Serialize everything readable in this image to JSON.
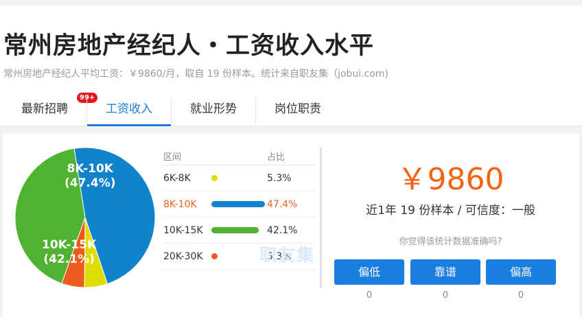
{
  "header": {
    "title": "常州房地产经纪人・工资收入水平",
    "subtitle": "常州房地产经纪人平均工资：￥9860/月，取自 19 份样本。统计来自职友集（jobui.com)"
  },
  "tabs": [
    {
      "label": "最新招聘",
      "badge": "99+"
    },
    {
      "label": "工资收入"
    },
    {
      "label": "就业形势"
    },
    {
      "label": "岗位职责"
    }
  ],
  "table": {
    "col_range": "区间",
    "col_ratio": "占比",
    "rows": [
      {
        "range": "6K-8K",
        "pct": "5.3%",
        "color": "#dedc00"
      },
      {
        "range": "8K-10K",
        "pct": "47.4%",
        "color": "#1183cc"
      },
      {
        "range": "10K-15K",
        "pct": "42.1%",
        "color": "#4fb331"
      },
      {
        "range": "20K-30K",
        "pct": "5.3%",
        "color": "#ed5a1b"
      }
    ]
  },
  "chart_data": {
    "type": "pie",
    "categories": [
      "6K-8K",
      "8K-10K",
      "10K-15K",
      "20K-30K"
    ],
    "values": [
      5.3,
      47.4,
      42.1,
      5.3
    ],
    "colors": [
      "#dedc00",
      "#1183cc",
      "#4fb331",
      "#ed5a1b"
    ],
    "labels": [
      {
        "name": "8K-10K",
        "value": "(47.4%)"
      },
      {
        "name": "10K-15K",
        "value": "(42.1%)"
      }
    ]
  },
  "watermark": "职友集",
  "summary": {
    "salary": "￥9860",
    "sample": "近1年 19 份样本 / 可信度：一般",
    "question": "你觉得该统计数据准确吗?"
  },
  "votes": [
    {
      "label": "偏低",
      "count": "0"
    },
    {
      "label": "靠谱",
      "count": "0"
    },
    {
      "label": "偏高",
      "count": "0"
    }
  ]
}
